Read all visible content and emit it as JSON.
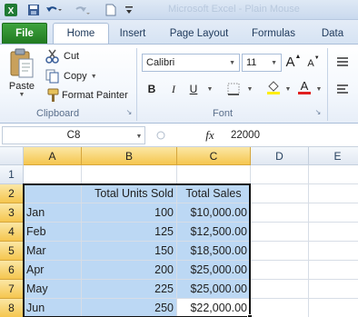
{
  "window": {
    "title_ghost": "Microsoft Excel - Plain Mouse"
  },
  "qat": {
    "file_icon_label": "X"
  },
  "tabs": [
    {
      "label": "File",
      "active": false
    },
    {
      "label": "Home",
      "active": true
    },
    {
      "label": "Insert",
      "active": false
    },
    {
      "label": "Page Layout",
      "active": false
    },
    {
      "label": "Formulas",
      "active": false
    },
    {
      "label": "Data",
      "active": false
    }
  ],
  "ribbon": {
    "clipboard": {
      "paste_label": "Paste",
      "cut_label": "Cut",
      "copy_label": "Copy",
      "format_painter_label": "Format Painter",
      "group_label": "Clipboard"
    },
    "font": {
      "font_name": "Calibri",
      "font_size": "11",
      "grow_label": "A",
      "shrink_label": "A",
      "bold_label": "B",
      "italic_label": "I",
      "underline_label": "U",
      "font_color_label": "A",
      "group_label": "Font"
    }
  },
  "formula_bar": {
    "name_box": "C8",
    "fx_label": "fx",
    "formula": "22000"
  },
  "sheet": {
    "columns": [
      "A",
      "B",
      "C",
      "D",
      "E"
    ],
    "rows": [
      "1",
      "2",
      "3",
      "4",
      "5",
      "6",
      "7",
      "8"
    ],
    "selected_columns": [
      "A",
      "B",
      "C"
    ],
    "selected_rows": [
      "2",
      "3",
      "4",
      "5",
      "6",
      "7",
      "8"
    ],
    "active_cell": "C8",
    "headers": {
      "a": "",
      "b": "Total Units Sold",
      "c": "Total Sales"
    },
    "data": [
      {
        "month": "Jan",
        "units": "100",
        "sales": "$10,000.00"
      },
      {
        "month": "Feb",
        "units": "125",
        "sales": "$12,500.00"
      },
      {
        "month": "Mar",
        "units": "150",
        "sales": "$18,500.00"
      },
      {
        "month": "Apr",
        "units": "200",
        "sales": "$25,000.00"
      },
      {
        "month": "May",
        "units": "225",
        "sales": "$25,000.00"
      },
      {
        "month": "Jun",
        "units": "250",
        "sales": "$22,000.00"
      }
    ]
  },
  "colors": {
    "selection_fill": "#bcd8f4",
    "header_highlight": "#f5c64f",
    "file_tab": "#2f8f2f",
    "font_color_bar": "#e02020",
    "highlight_bar": "#ffee00"
  }
}
